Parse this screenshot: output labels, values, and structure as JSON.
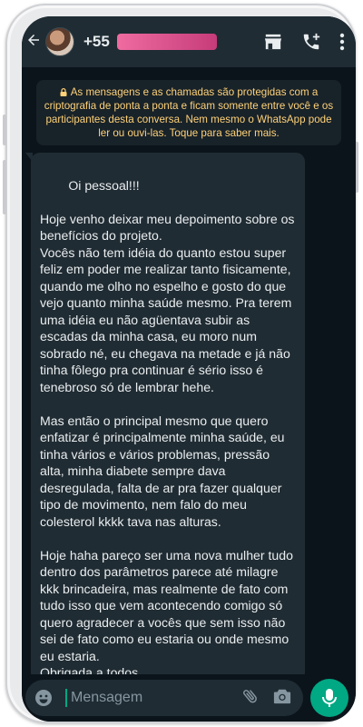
{
  "header": {
    "contact_name": "+55",
    "back_icon": "arrow-left-icon",
    "icons": [
      "store-icon",
      "call-add-icon",
      "more-vertical-icon"
    ]
  },
  "notice": {
    "text": "As mensagens e as chamadas são protegidas com a criptografia de ponta a ponta e ficam somente entre você e os participantes desta conversa. Nem mesmo o WhatsApp pode ler ou ouvi-las. Toque para saber mais.",
    "icon": "lock-icon"
  },
  "message": {
    "text": "Oi pessoal!!!\n\nHoje venho deixar meu depoimento sobre os benefícios do projeto.\nVocês não tem idéia do quanto estou super feliz em poder me realizar tanto fisicamente, quando me olho no espelho e gosto do que vejo quanto minha saúde mesmo. Pra terem uma idéia eu não agüentava subir as escadas da minha casa, eu moro num sobrado né, eu chegava na metade e já não tinha fôlego pra continuar é sério isso é tenebroso só de lembrar hehe.\n\nMas então o principal mesmo que quero enfatizar é principalmente minha saúde, eu tinha vários e vários problemas, pressão alta, minha diabete sempre dava desregulada, falta de ar pra fazer qualquer tipo de movimento, nem falo do meu colesterol kkkk tava nas alturas.\n\nHoje haha pareço ser uma nova mulher tudo dentro dos parâmetros parece até milagre kkk brincadeira, mas realmente de fato com tudo isso que vem acontecendo comigo só quero agradecer a vocês que sem isso não sei de fato como eu estaria ou onde mesmo eu estaria.\nObrigada a todos."
  },
  "composer": {
    "placeholder": "Mensagem",
    "icons": [
      "emoji-icon",
      "attach-icon",
      "camera-icon",
      "mic-icon"
    ]
  },
  "colors": {
    "header_bg": "#1f2c34",
    "chat_bg": "#0b141a",
    "bubble_bg": "#202c33",
    "notice_text": "#ffd279",
    "accent": "#00a884"
  }
}
